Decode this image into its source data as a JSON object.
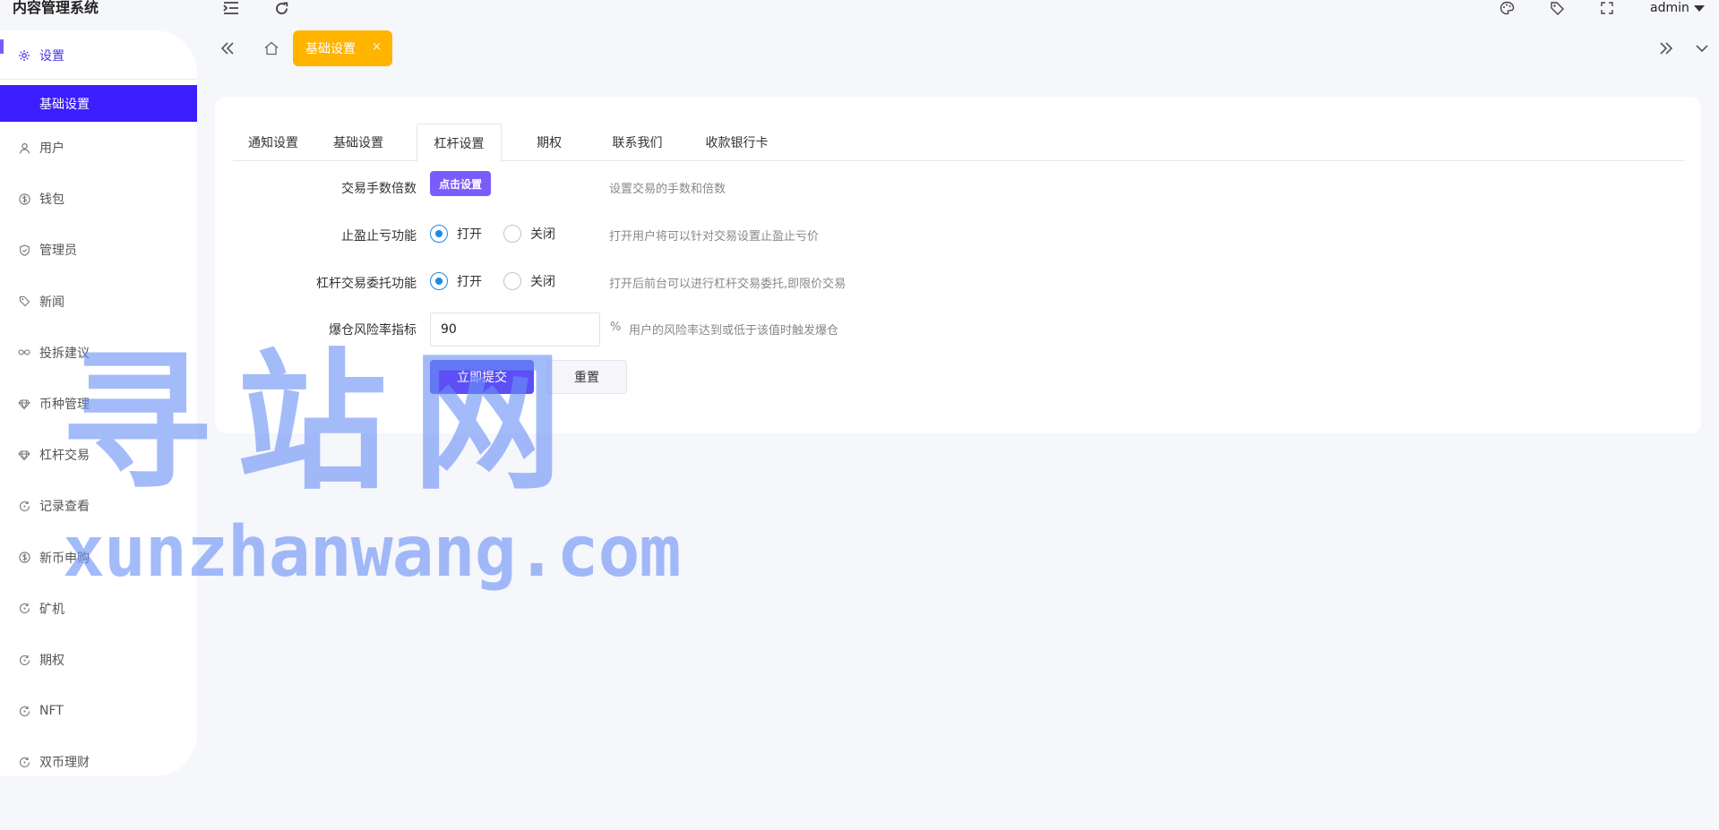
{
  "app": {
    "title": "内容管理系统",
    "user": "admin"
  },
  "topbar": {
    "icons": [
      "menu-collapse-icon",
      "refresh-icon",
      "palette-icon",
      "tag-icon",
      "fullscreen-icon"
    ]
  },
  "sidebar": {
    "section": "设置",
    "active_sub": "基础设置",
    "items": [
      {
        "label": "用户",
        "icon": "user-icon"
      },
      {
        "label": "钱包",
        "icon": "dollar-icon"
      },
      {
        "label": "管理员",
        "icon": "shield-icon"
      },
      {
        "label": "新闻",
        "icon": "tag-icon"
      },
      {
        "label": "投拆建议",
        "icon": "infinity-icon"
      },
      {
        "label": "币种管理",
        "icon": "diamond-icon"
      },
      {
        "label": "杠杆交易",
        "icon": "diamond-icon"
      },
      {
        "label": "记录查看",
        "icon": "rotate-icon"
      },
      {
        "label": "新币申购",
        "icon": "dollar-icon"
      },
      {
        "label": "矿机",
        "icon": "rotate-icon"
      },
      {
        "label": "期权",
        "icon": "rotate-icon"
      },
      {
        "label": "NFT",
        "icon": "rotate-icon"
      },
      {
        "label": "双币理财",
        "icon": "rotate-icon"
      }
    ]
  },
  "page_tabs": {
    "active": "基础设置",
    "close": "×"
  },
  "tabs": [
    "通知设置",
    "基础设置",
    "杠杆设置",
    "期权",
    "联系我们",
    "收款银行卡"
  ],
  "active_tab": "杠杆设置",
  "form": {
    "fee": {
      "label": "交易手数倍数",
      "button": "点击设置",
      "tip": "设置交易的手数和倍数"
    },
    "stop_loss": {
      "label": "止盈止亏功能",
      "on": "打开",
      "off": "关闭",
      "value": "打开",
      "tip": "打开用户将可以针对交易设置止盈止亏价"
    },
    "order": {
      "label": "杠杆交易委托功能",
      "on": "打开",
      "off": "关闭",
      "value": "打开",
      "tip": "打开后前台可以进行杠杆交易委托,即限价交易"
    },
    "risk": {
      "label": "爆仓风险率指标",
      "value": "90",
      "unit": "%",
      "tip": "用户的风险率达到或低于该值时触发爆仓"
    },
    "submit": "立即提交",
    "reset": "重置"
  },
  "watermark": {
    "cn": "寻站网",
    "en": "xunzhanwang.com"
  }
}
